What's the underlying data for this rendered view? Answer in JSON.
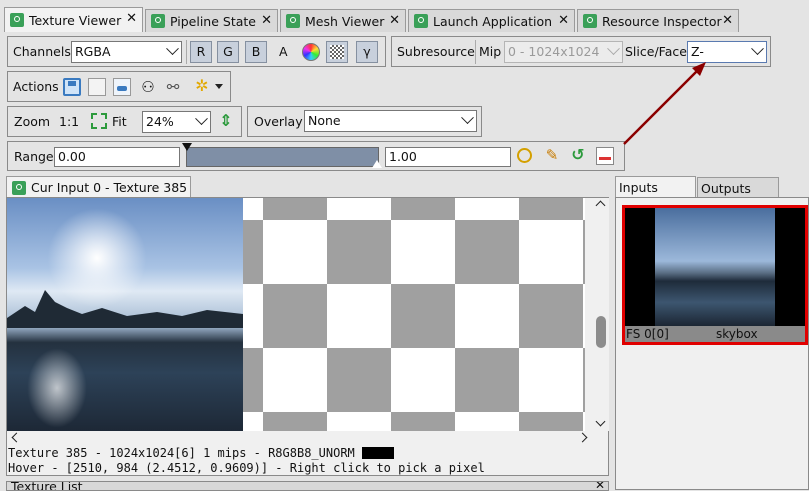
{
  "tabs": [
    {
      "label": "Texture Viewer",
      "active": true
    },
    {
      "label": "Pipeline State"
    },
    {
      "label": "Mesh Viewer"
    },
    {
      "label": "Launch Application"
    },
    {
      "label": "Resource Inspector"
    }
  ],
  "channels": {
    "label": "Channels",
    "value": "RGBA",
    "r": "R",
    "g": "G",
    "b": "B",
    "a": "A",
    "gamma": "γ"
  },
  "subresource": {
    "label": "Subresource",
    "mip_label": "Mip",
    "mip_value": "0 - 1024x1024",
    "slice_label": "Slice/Face",
    "slice_value": "Z-"
  },
  "actions": {
    "label": "Actions"
  },
  "zoom": {
    "label": "Zoom",
    "one_to_one": "1:1",
    "fit": "Fit",
    "value": "24%"
  },
  "overlay": {
    "label": "Overlay",
    "value": "None"
  },
  "range": {
    "label": "Range",
    "min": "0.00",
    "max": "1.00"
  },
  "viewer": {
    "tab_title": "Cur Input 0 - Texture 385",
    "status_line1": "Texture 385 -  1024x1024[6] 1 mips -  R8G8B8_UNORM",
    "status_line2": "Hover - [2510,  984 (2.4512, 0.9609)] - Right click to pick a pixel"
  },
  "thumbs": {
    "inputs_tab": "Inputs",
    "outputs_tab": "Outputs",
    "slot": "FS 0[0]",
    "name": "skybox"
  },
  "texture_list": {
    "label": "Texture List"
  },
  "colors": {
    "accent": "#3aa058",
    "selected_border": "#e00000",
    "arrow": "#8b0000"
  }
}
